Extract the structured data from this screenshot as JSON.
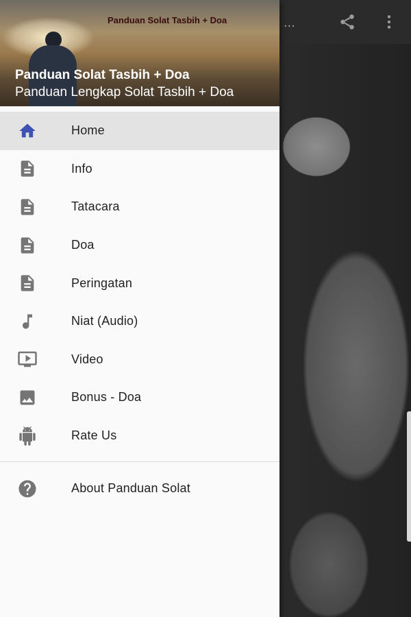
{
  "app": {
    "toolbar_title": "...",
    "share_icon": "share-icon",
    "more_icon": "more-vert-icon"
  },
  "drawer": {
    "header": {
      "banner_text": "Panduan Solat Tasbih + Doa",
      "title": "Panduan Solat Tasbih + Doa",
      "subtitle": "Panduan Lengkap Solat Tasbih + Doa"
    },
    "items": [
      {
        "label": "Home",
        "icon": "home-icon",
        "active": true
      },
      {
        "label": "Info",
        "icon": "document-icon",
        "active": false
      },
      {
        "label": "Tatacara",
        "icon": "document-icon",
        "active": false
      },
      {
        "label": "Doa",
        "icon": "document-icon",
        "active": false
      },
      {
        "label": "Peringatan",
        "icon": "document-icon",
        "active": false
      },
      {
        "label": "Niat (Audio)",
        "icon": "music-note-icon",
        "active": false
      },
      {
        "label": "Video",
        "icon": "tv-icon",
        "active": false
      },
      {
        "label": "Bonus - Doa",
        "icon": "image-icon",
        "active": false
      },
      {
        "label": "Rate Us",
        "icon": "android-icon",
        "active": false
      }
    ],
    "secondary": {
      "label": "About Panduan Solat",
      "icon": "help-circle-icon"
    }
  },
  "colors": {
    "active_icon": "#3f51b5",
    "icon_gray": "#757575",
    "active_row": "#e3e3e3"
  }
}
